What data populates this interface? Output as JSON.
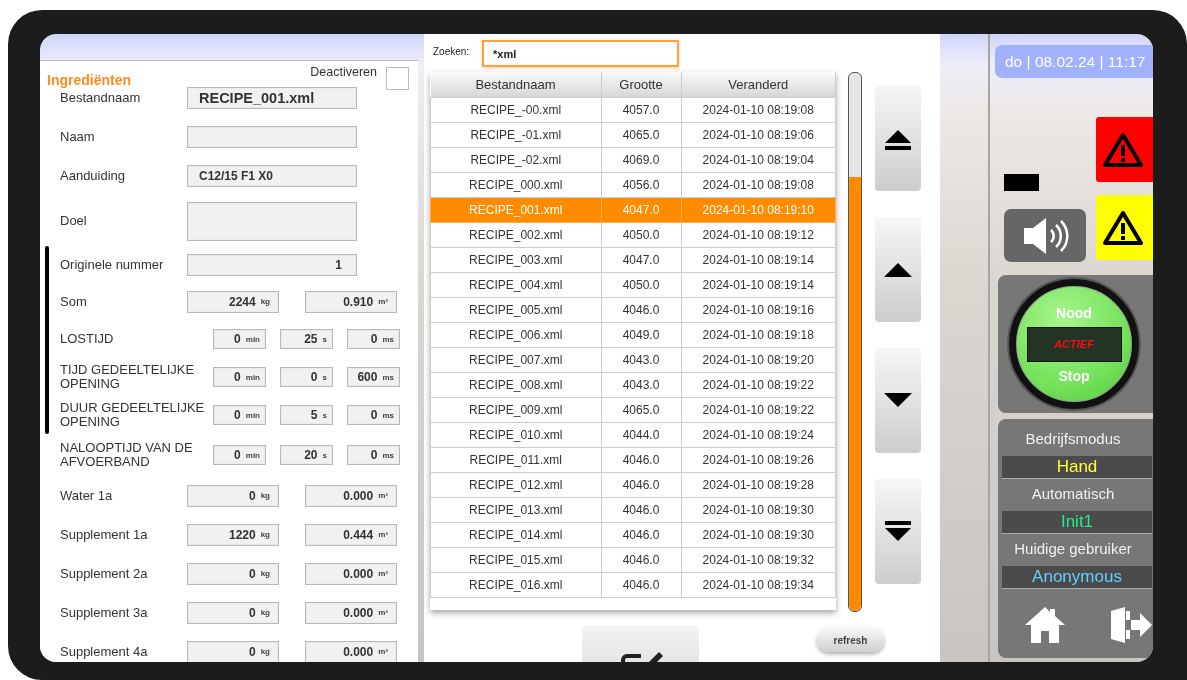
{
  "left_panel": {
    "title": "Ingrediënten",
    "deactivate": {
      "label": "Deactiveren",
      "checked": false
    },
    "rows": [
      {
        "kind": "filename",
        "label": "Bestandnaam",
        "value": "RECIPE_001.xml"
      },
      {
        "kind": "text",
        "label": "Naam"
      },
      {
        "kind": "text",
        "label": "Aanduiding",
        "value": "C12/15 F1 X0"
      },
      {
        "kind": "tall",
        "label": "Doel"
      },
      {
        "kind": "group",
        "rows": [
          {
            "kind": "number",
            "label": "Originele nummer",
            "value": "1"
          },
          {
            "kind": "measure",
            "label": "Som",
            "fields": [
              {
                "value": "2244",
                "unit": "kg"
              },
              {
                "value": "0.910",
                "unit": "m³"
              }
            ]
          },
          {
            "kind": "time",
            "label": "LOSTIJD",
            "fields": [
              {
                "value": "0",
                "unit": "min"
              },
              {
                "value": "25",
                "unit": "s"
              },
              {
                "value": "0",
                "unit": "ms"
              }
            ]
          },
          {
            "kind": "time",
            "label": "TIJD GEDEELTELIJKE OPENING",
            "fields": [
              {
                "value": "0",
                "unit": "min"
              },
              {
                "value": "0",
                "unit": "s"
              },
              {
                "value": "600",
                "unit": "ms"
              }
            ]
          },
          {
            "kind": "time",
            "label": "DUUR GEDEELTELIJKE OPENING",
            "fields": [
              {
                "value": "0",
                "unit": "min"
              },
              {
                "value": "5",
                "unit": "s"
              },
              {
                "value": "0",
                "unit": "ms"
              }
            ]
          }
        ]
      },
      {
        "kind": "time",
        "label": "NALOOPTIJD VAN DE AFVOERBAND",
        "fields": [
          {
            "value": "0",
            "unit": "min"
          },
          {
            "value": "20",
            "unit": "s"
          },
          {
            "value": "0",
            "unit": "ms"
          }
        ]
      },
      {
        "kind": "measure",
        "label": "Water 1a",
        "fields": [
          {
            "value": "0",
            "unit": "kg"
          },
          {
            "value": "0.000",
            "unit": "m³"
          }
        ]
      },
      {
        "kind": "measure",
        "label": "Supplement 1a",
        "fields": [
          {
            "value": "1220",
            "unit": "kg"
          },
          {
            "value": "0.444",
            "unit": "m³"
          }
        ]
      },
      {
        "kind": "measure",
        "label": "Supplement 2a",
        "fields": [
          {
            "value": "0",
            "unit": "kg"
          },
          {
            "value": "0.000",
            "unit": "m³"
          }
        ]
      },
      {
        "kind": "measure",
        "label": "Supplement 3a",
        "fields": [
          {
            "value": "0",
            "unit": "kg"
          },
          {
            "value": "0.000",
            "unit": "m³"
          }
        ]
      },
      {
        "kind": "measure",
        "label": "Supplement 4a",
        "fields": [
          {
            "value": "0",
            "unit": "kg"
          },
          {
            "value": "0.000",
            "unit": "m³"
          }
        ]
      }
    ]
  },
  "file_browser": {
    "search": {
      "label": "Zoeken:",
      "value": "*xml"
    },
    "table": {
      "columns": [
        "Bestandnaam",
        "Grootte",
        "Veranderd"
      ],
      "rows": [
        {
          "cells": [
            "RECIPE_-00.xml",
            "4057.0",
            "2024-01-10 08:19:08"
          ],
          "selected": false
        },
        {
          "cells": [
            "RECIPE_-01.xml",
            "4065.0",
            "2024-01-10 08:19:06"
          ],
          "selected": false
        },
        {
          "cells": [
            "RECIPE_-02.xml",
            "4069.0",
            "2024-01-10 08:19:04"
          ],
          "selected": false
        },
        {
          "cells": [
            "RECIPE_000.xml",
            "4056.0",
            "2024-01-10 08:19:08"
          ],
          "selected": false
        },
        {
          "cells": [
            "RECIPE_001.xml",
            "4047.0",
            "2024-01-10 08:19:10"
          ],
          "selected": true
        },
        {
          "cells": [
            "RECIPE_002.xml",
            "4050.0",
            "2024-01-10 08:19:12"
          ],
          "selected": false
        },
        {
          "cells": [
            "RECIPE_003.xml",
            "4047.0",
            "2024-01-10 08:19:14"
          ],
          "selected": false
        },
        {
          "cells": [
            "RECIPE_004.xml",
            "4050.0",
            "2024-01-10 08:19:14"
          ],
          "selected": false
        },
        {
          "cells": [
            "RECIPE_005.xml",
            "4046.0",
            "2024-01-10 08:19:16"
          ],
          "selected": false
        },
        {
          "cells": [
            "RECIPE_006.xml",
            "4049.0",
            "2024-01-10 08:19:18"
          ],
          "selected": false
        },
        {
          "cells": [
            "RECIPE_007.xml",
            "4043.0",
            "2024-01-10 08:19:20"
          ],
          "selected": false
        },
        {
          "cells": [
            "RECIPE_008.xml",
            "4043.0",
            "2024-01-10 08:19:22"
          ],
          "selected": false
        },
        {
          "cells": [
            "RECIPE_009.xml",
            "4065.0",
            "2024-01-10 08:19:22"
          ],
          "selected": false
        },
        {
          "cells": [
            "RECIPE_010.xml",
            "4044.0",
            "2024-01-10 08:19:24"
          ],
          "selected": false
        },
        {
          "cells": [
            "RECIPE_011.xml",
            "4046.0",
            "2024-01-10 08:19:26"
          ],
          "selected": false
        },
        {
          "cells": [
            "RECIPE_012.xml",
            "4046.0",
            "2024-01-10 08:19:28"
          ],
          "selected": false
        },
        {
          "cells": [
            "RECIPE_013.xml",
            "4046.0",
            "2024-01-10 08:19:30"
          ],
          "selected": false
        },
        {
          "cells": [
            "RECIPE_014.xml",
            "4046.0",
            "2024-01-10 08:19:30"
          ],
          "selected": false
        },
        {
          "cells": [
            "RECIPE_015.xml",
            "4046.0",
            "2024-01-10 08:19:32"
          ],
          "selected": false
        },
        {
          "cells": [
            "RECIPE_016.xml",
            "4046.0",
            "2024-01-10 08:19:34"
          ],
          "selected": false
        }
      ]
    },
    "nav_buttons": [
      {
        "kind": "first"
      },
      {
        "kind": "up"
      },
      {
        "kind": "down"
      },
      {
        "kind": "last"
      }
    ],
    "refresh_button": {
      "label": "refresh"
    }
  },
  "status_panel": {
    "datetime": "do | 08.02.24 | 11:17",
    "alerts": [
      {
        "kind": "alarm"
      },
      {
        "kind": "warning"
      }
    ],
    "emergency": {
      "top": "Nood",
      "display": "ACTIEF",
      "bottom": "Stop"
    },
    "modes": [
      {
        "label": "Bedrijfsmodus",
        "value": "Hand",
        "color": "#ffff33"
      },
      {
        "label": "Automatisch",
        "value": "Init1",
        "color": "#22ee88"
      },
      {
        "label": "Huidige gebruiker",
        "value": "Anonymous",
        "color": "#66ccff"
      }
    ]
  }
}
